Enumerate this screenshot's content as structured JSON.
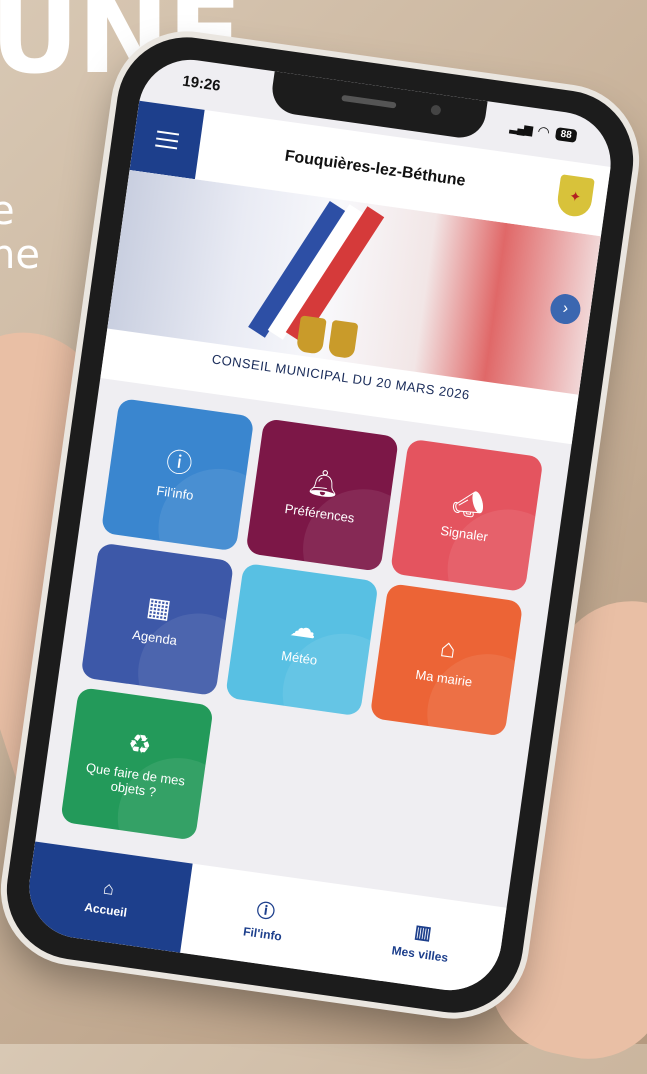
{
  "background": {
    "big_text": "UNE",
    "line1": "e",
    "line2": "ne"
  },
  "status_bar": {
    "time": "19:26",
    "battery": "88"
  },
  "header": {
    "title": "Fouquières-lez-Béthune"
  },
  "banner": {
    "caption": "CONSEIL MUNICIPAL DU 20 MARS 2026"
  },
  "tiles": [
    {
      "label": "Fil'info",
      "icon": "info-icon",
      "color": "#3a86cf"
    },
    {
      "label": "Préférences",
      "icon": "bell-icon",
      "color": "#7c1747"
    },
    {
      "label": "Signaler",
      "icon": "megaphone-icon",
      "color": "#e4545f"
    },
    {
      "label": "Agenda",
      "icon": "calendar-icon",
      "color": "#3d58a8"
    },
    {
      "label": "Météo",
      "icon": "weather-icon",
      "color": "#58c0e3"
    },
    {
      "label": "Ma mairie",
      "icon": "town-hall-icon",
      "color": "#ec6436"
    },
    {
      "label": "Que faire de mes objets ?",
      "icon": "recycle-hand-icon",
      "color": "#239a5a"
    }
  ],
  "bottom_nav": [
    {
      "label": "Accueil",
      "icon": "home-icon",
      "active": true
    },
    {
      "label": "Fil'info",
      "icon": "info-icon",
      "active": false
    },
    {
      "label": "Mes villes",
      "icon": "buildings-icon",
      "active": false
    }
  ],
  "colors": {
    "primary": "#1d3f8c"
  }
}
